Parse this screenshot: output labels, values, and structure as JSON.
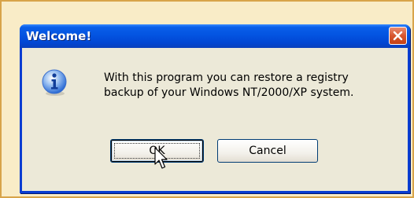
{
  "dialog": {
    "title": "Welcome!",
    "message_lines": [
      "With this program you can restore a registry",
      "backup of your Windows NT/2000/XP system."
    ],
    "buttons": {
      "ok_label": "OK",
      "cancel_label": "Cancel"
    }
  },
  "icons": {
    "dialog_icon": "info-icon",
    "close": "close-icon",
    "pointer": "mouse-pointer-icon"
  },
  "colors": {
    "titlebar": "#0354e1",
    "dialog_bg": "#ece9d8",
    "close_button": "#d7562f",
    "outer_bg": "#f9ecc7"
  }
}
